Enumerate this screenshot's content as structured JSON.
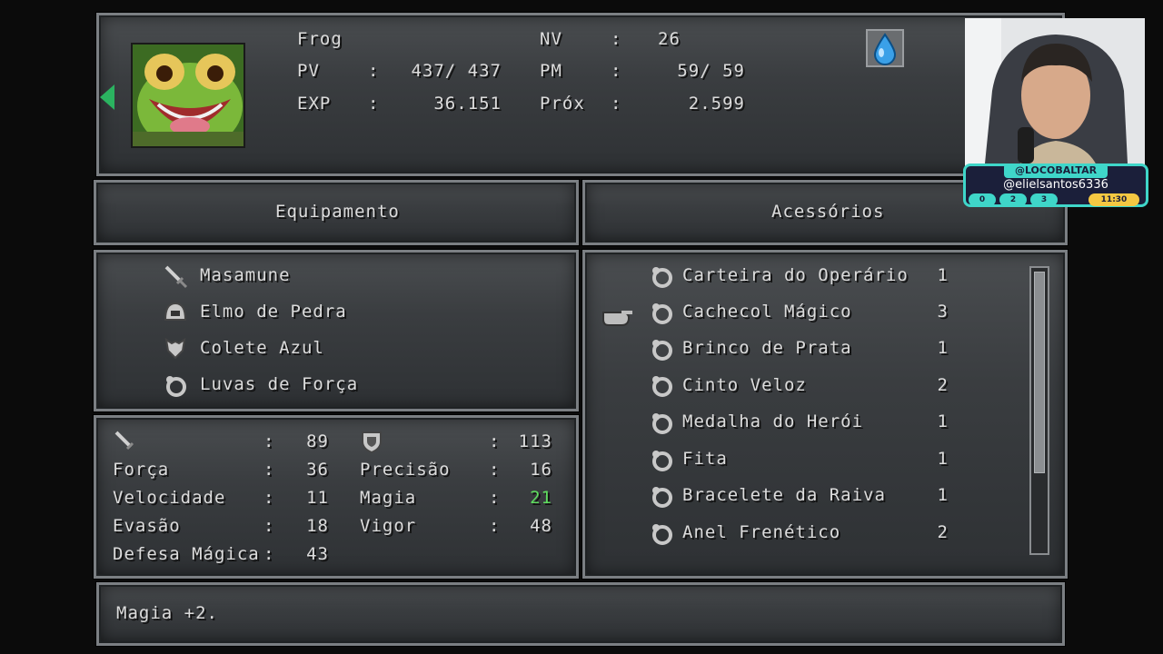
{
  "character": {
    "name": "Frog",
    "level_label": "NV",
    "level": "26",
    "hp_label": "PV",
    "hp": "437/ 437",
    "mp_label": "PM",
    "mp": "59/  59",
    "exp_label": "EXP",
    "exp": "36.151",
    "next_label": "Próx",
    "next": "2.599",
    "element_icon": "water-drop-icon"
  },
  "headers": {
    "equipment": "Equipamento",
    "accessories": "Acessórios"
  },
  "equipment": [
    {
      "icon": "sword-icon",
      "name": "Masamune"
    },
    {
      "icon": "helmet-icon",
      "name": "Elmo de Pedra"
    },
    {
      "icon": "armor-icon",
      "name": "Colete Azul"
    },
    {
      "icon": "ring-icon",
      "name": "Luvas de Força"
    }
  ],
  "stats": {
    "attack": "89",
    "defense": "113",
    "strength_label": "Força",
    "strength": "36",
    "accuracy_label": "Precisão",
    "accuracy": "16",
    "speed_label": "Velocidade",
    "speed": "11",
    "magic_label": "Magia",
    "magic": "21",
    "evasion_label": "Evasão",
    "evasion": "18",
    "stamina_label": "Vigor",
    "stamina": "48",
    "mdef_label": "Defesa Mágica",
    "mdef": "43",
    "colon": ":",
    "magic_color": "#5fdc5f"
  },
  "accessories": [
    {
      "name": "Carteira do Operário",
      "qty": "1"
    },
    {
      "name": "Cachecol Mágico",
      "qty": "3"
    },
    {
      "name": "Brinco de Prata",
      "qty": "1"
    },
    {
      "name": "Cinto Veloz",
      "qty": "2"
    },
    {
      "name": "Medalha do Herói",
      "qty": "1"
    },
    {
      "name": "Fita",
      "qty": "1"
    },
    {
      "name": "Bracelete da Raiva",
      "qty": "1"
    },
    {
      "name": "Anel Frenético",
      "qty": "2"
    }
  ],
  "description": "Magia +2.",
  "overlay": {
    "handle_top": "@LOCOBALTAR",
    "handle_main": "@elielsantos6336",
    "counts": [
      "0",
      "2",
      "3"
    ],
    "time": "11:30"
  }
}
